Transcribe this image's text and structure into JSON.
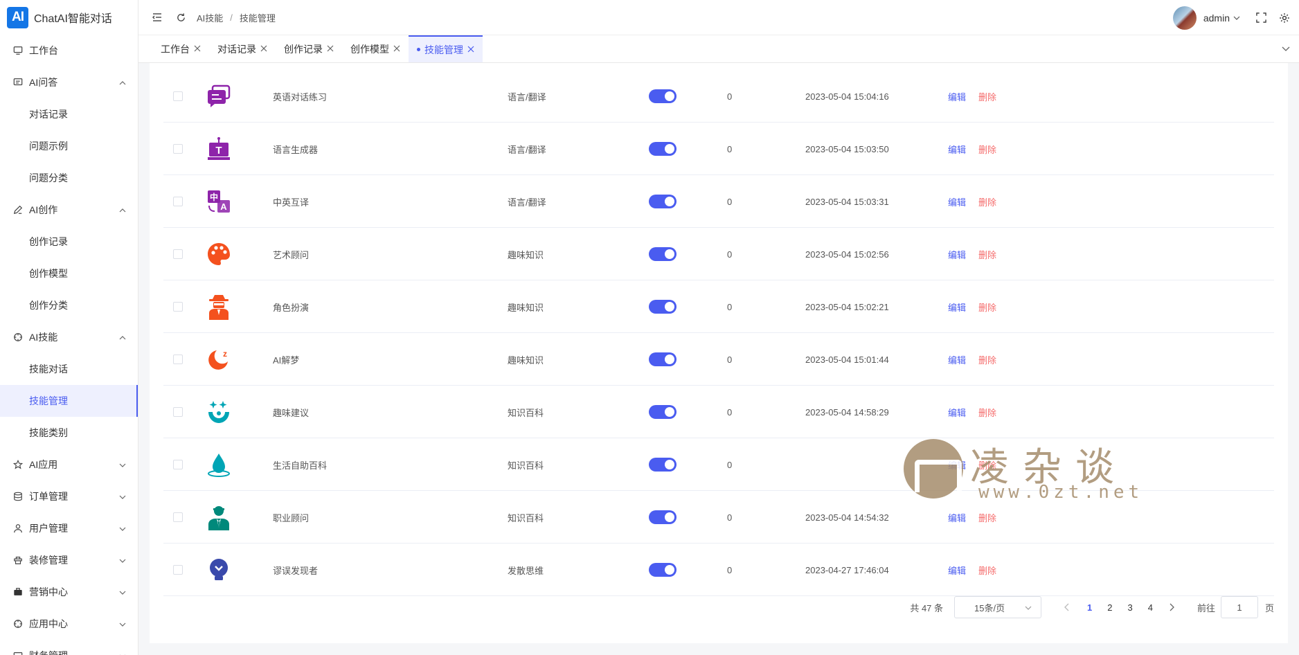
{
  "app": {
    "logo_text": "AI",
    "title": "ChatAI智能对话"
  },
  "sidebar": {
    "items": [
      {
        "label": "工作台",
        "icon": "monitor-icon",
        "type": "item"
      },
      {
        "label": "AI问答",
        "icon": "message-icon",
        "type": "group",
        "expanded": true
      },
      {
        "label": "对话记录",
        "type": "sub"
      },
      {
        "label": "问题示例",
        "type": "sub"
      },
      {
        "label": "问题分类",
        "type": "sub"
      },
      {
        "label": "AI创作",
        "icon": "pen-icon",
        "type": "group",
        "expanded": true
      },
      {
        "label": "创作记录",
        "type": "sub"
      },
      {
        "label": "创作模型",
        "type": "sub"
      },
      {
        "label": "创作分类",
        "type": "sub"
      },
      {
        "label": "AI技能",
        "icon": "crosshair-icon",
        "type": "group",
        "expanded": true
      },
      {
        "label": "技能对话",
        "type": "sub"
      },
      {
        "label": "技能管理",
        "type": "sub",
        "active": true
      },
      {
        "label": "技能类别",
        "type": "sub"
      },
      {
        "label": "AI应用",
        "icon": "star-icon",
        "type": "group",
        "expanded": false
      },
      {
        "label": "订单管理",
        "icon": "database-icon",
        "type": "group",
        "expanded": false
      },
      {
        "label": "用户管理",
        "icon": "user-icon",
        "type": "group",
        "expanded": false
      },
      {
        "label": "装修管理",
        "icon": "palette-icon",
        "type": "group",
        "expanded": false
      },
      {
        "label": "营销中心",
        "icon": "briefcase-icon",
        "type": "group",
        "expanded": false
      },
      {
        "label": "应用中心",
        "icon": "crosshair-icon",
        "type": "group",
        "expanded": false
      },
      {
        "label": "财务管理",
        "icon": "wallet-icon",
        "type": "group",
        "expanded": false
      }
    ]
  },
  "header": {
    "breadcrumb": [
      "AI技能",
      "技能管理"
    ],
    "breadcrumb_sep": "/",
    "user_name": "admin"
  },
  "tabs": [
    {
      "label": "工作台",
      "active": false
    },
    {
      "label": "对话记录",
      "active": false
    },
    {
      "label": "创作记录",
      "active": false
    },
    {
      "label": "创作模型",
      "active": false
    },
    {
      "label": "技能管理",
      "active": true
    }
  ],
  "table": {
    "rows": [
      {
        "icon": "chat-bubbles-icon",
        "icon_color": "#8e24aa",
        "name": "英语对话练习",
        "category": "语言/翻译",
        "enabled": true,
        "count": "0",
        "created": "2023-05-04 15:04:16"
      },
      {
        "icon": "text-generator-icon",
        "icon_color": "#8e24aa",
        "name": "语言生成器",
        "category": "语言/翻译",
        "enabled": true,
        "count": "0",
        "created": "2023-05-04 15:03:50"
      },
      {
        "icon": "translate-icon",
        "icon_color": "#8e24aa",
        "name": "中英互译",
        "category": "语言/翻译",
        "enabled": true,
        "count": "0",
        "created": "2023-05-04 15:03:31"
      },
      {
        "icon": "palette-icon",
        "icon_color": "#f4511e",
        "name": "艺术顾问",
        "category": "趣味知识",
        "enabled": true,
        "count": "0",
        "created": "2023-05-04 15:02:56"
      },
      {
        "icon": "detective-icon",
        "icon_color": "#f4511e",
        "name": "角色扮演",
        "category": "趣味知识",
        "enabled": true,
        "count": "0",
        "created": "2023-05-04 15:02:21"
      },
      {
        "icon": "moon-sleep-icon",
        "icon_color": "#f4511e",
        "name": "AI解梦",
        "category": "趣味知识",
        "enabled": true,
        "count": "0",
        "created": "2023-05-04 15:01:44"
      },
      {
        "icon": "sparkle-face-icon",
        "icon_color": "#00a5b5",
        "name": "趣味建议",
        "category": "知识百科",
        "enabled": true,
        "count": "0",
        "created": "2023-05-04 14:58:29"
      },
      {
        "icon": "water-drop-icon",
        "icon_color": "#00a5b5",
        "name": "生活自助百科",
        "category": "知识百科",
        "enabled": true,
        "count": "0",
        "created": ""
      },
      {
        "icon": "professional-icon",
        "icon_color": "#00897b",
        "name": "职业顾问",
        "category": "知识百科",
        "enabled": true,
        "count": "0",
        "created": "2023-05-04 14:54:32"
      },
      {
        "icon": "lightbulb-icon",
        "icon_color": "#3949ab",
        "name": "谬误发现者",
        "category": "发散思维",
        "enabled": true,
        "count": "0",
        "created": "2023-04-27 17:46:04"
      }
    ],
    "edit_label": "编辑",
    "delete_label": "删除"
  },
  "pagination": {
    "total_label": "共 47 条",
    "page_size": "15条/页",
    "pages": [
      "1",
      "2",
      "3",
      "4"
    ],
    "current": "1",
    "goto_label": "前往",
    "goto_value": "1",
    "page_unit": "页"
  },
  "watermark": {
    "title": "凌杂谈",
    "url": "www.0zt.net"
  },
  "colors": {
    "accent": "#4a5cf0",
    "danger": "#f56c6c",
    "logo": "#1476e6"
  }
}
